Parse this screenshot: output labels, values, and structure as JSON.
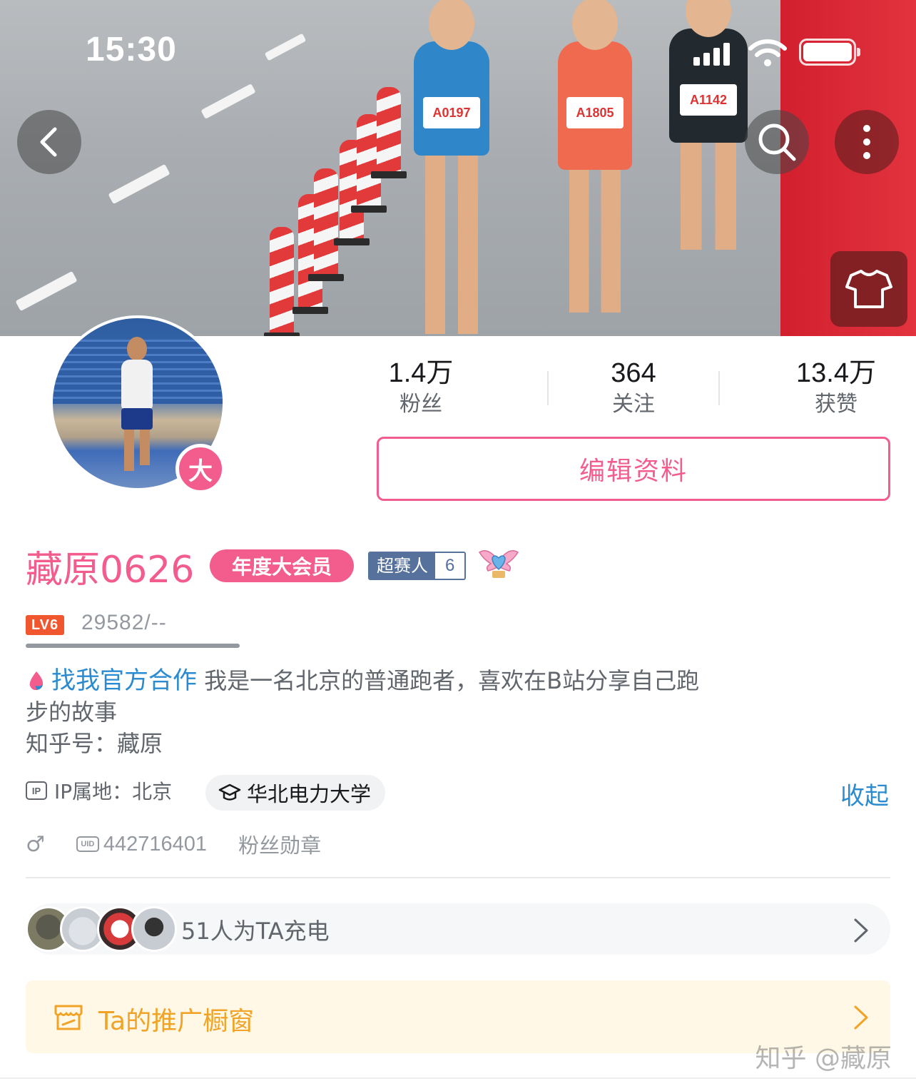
{
  "status_bar": {
    "time": "15:30"
  },
  "stats": [
    {
      "value": "1.4万",
      "label": "粉丝"
    },
    {
      "value": "364",
      "label": "关注"
    },
    {
      "value": "13.4万",
      "label": "获赞"
    }
  ],
  "edit_button": "编辑资料",
  "avatar_badge": "大",
  "user": {
    "name": "藏原0626",
    "vip_tag": "年度大会员",
    "race_badge_label": "超赛人",
    "race_badge_level": "6",
    "level_badge": "LV6",
    "exp": "29582/--"
  },
  "bio": {
    "coop_link": "找我官方合作",
    "text_line1": "我是一名北京的普通跑者，喜欢在B站分享自己跑",
    "text_line2": "步的故事",
    "text_line3": "知乎号：藏原"
  },
  "meta": {
    "ip_icon": "IP",
    "ip_location": "IP属地：北京",
    "school": "华北电力大学",
    "collapse": "收起",
    "gender_icon": "♂",
    "uid_icon": "UID",
    "uid": "442716401",
    "fan_medal": "粉丝勋章"
  },
  "charge": {
    "text": "51人为TA充电"
  },
  "shop": {
    "text": "Ta的推广橱窗"
  },
  "watermark": "知乎 @藏原",
  "banner_bibs": [
    "A0197",
    "A1805",
    "A1142"
  ],
  "icons": [
    "back-icon",
    "search-icon",
    "more-icon",
    "shirt-icon",
    "signal-icon",
    "wifi-icon",
    "battery-icon",
    "wing-icon",
    "coop-icon",
    "school-icon",
    "chevron-right-icon",
    "shop-icon"
  ],
  "colors": {
    "brand_pink": "#f25d8e",
    "link_blue": "#2b8bd1",
    "shop_orange": "#f0a326",
    "level_orange": "#f0572f"
  }
}
